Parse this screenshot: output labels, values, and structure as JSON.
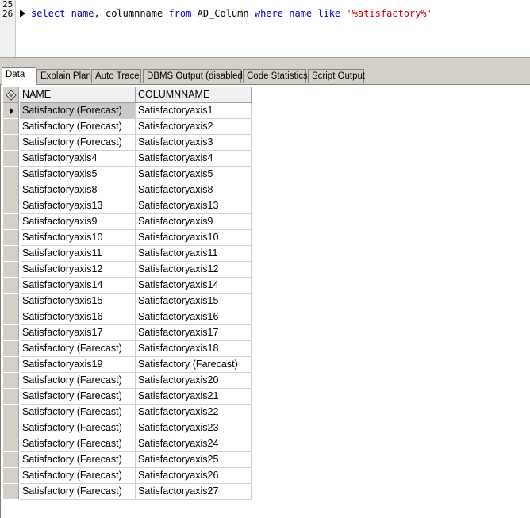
{
  "editor": {
    "line_numbers": [
      "25",
      "26"
    ],
    "sql": {
      "kw_select": "select",
      "col_name": "name",
      "comma": ",",
      "col_columnname": "columnname",
      "kw_from": "from",
      "table": "AD_Column",
      "kw_where": "where",
      "col_name2": "name",
      "kw_like": "like",
      "pattern": "'%atisfactory%'"
    }
  },
  "tabs": [
    {
      "label": "Data",
      "active": true
    },
    {
      "label": "Explain Plan",
      "active": false
    },
    {
      "label": "Auto Trace",
      "active": false
    },
    {
      "label": "DBMS Output (disabled)",
      "active": false
    },
    {
      "label": "Code Statistics",
      "active": false
    },
    {
      "label": "Script Output",
      "active": false
    }
  ],
  "grid": {
    "columns": [
      "NAME",
      "COLUMNNAME"
    ],
    "rows": [
      [
        "Satisfactory (Forecast)",
        "Satisfactoryaxis1"
      ],
      [
        "Satisfactory (Forecast)",
        "Satisfactoryaxis2"
      ],
      [
        "Satisfactory (Forecast)",
        "Satisfactoryaxis3"
      ],
      [
        "Satisfactoryaxis4",
        "Satisfactoryaxis4"
      ],
      [
        "Satisfactoryaxis5",
        "Satisfactoryaxis5"
      ],
      [
        "Satisfactoryaxis8",
        "Satisfactoryaxis8"
      ],
      [
        "Satisfactoryaxis13",
        "Satisfactoryaxis13"
      ],
      [
        "Satisfactoryaxis9",
        "Satisfactoryaxis9"
      ],
      [
        "Satisfactoryaxis10",
        "Satisfactoryaxis10"
      ],
      [
        "Satisfactoryaxis11",
        "Satisfactoryaxis11"
      ],
      [
        "Satisfactoryaxis12",
        "Satisfactoryaxis12"
      ],
      [
        "Satisfactoryaxis14",
        "Satisfactoryaxis14"
      ],
      [
        "Satisfactoryaxis15",
        "Satisfactoryaxis15"
      ],
      [
        "Satisfactoryaxis16",
        "Satisfactoryaxis16"
      ],
      [
        "Satisfactoryaxis17",
        "Satisfactoryaxis17"
      ],
      [
        "Satisfactory (Farecast)",
        "Satisfactoryaxis18"
      ],
      [
        "Satisfactoryaxis19",
        "Satisfactory (Farecast)"
      ],
      [
        "Satisfactory (Farecast)",
        "Satisfactoryaxis20"
      ],
      [
        "Satisfactory (Farecast)",
        "Satisfactoryaxis21"
      ],
      [
        "Satisfactory (Farecast)",
        "Satisfactoryaxis22"
      ],
      [
        "Satisfactory  (Farecast)",
        "Satisfactoryaxis23"
      ],
      [
        "Satisfactory (Farecast)",
        "Satisfactoryaxis24"
      ],
      [
        "Satisfactory (Farecast)",
        "Satisfactoryaxis25"
      ],
      [
        "Satisfactory (Farecast)",
        "Satisfactoryaxis26"
      ],
      [
        "Satisfactory (Farecast)",
        "Satisfactoryaxis27"
      ]
    ],
    "selected_row": 0,
    "header_icon": "column-selector-icon",
    "row_pointer_icon": "current-row-arrow-icon"
  }
}
